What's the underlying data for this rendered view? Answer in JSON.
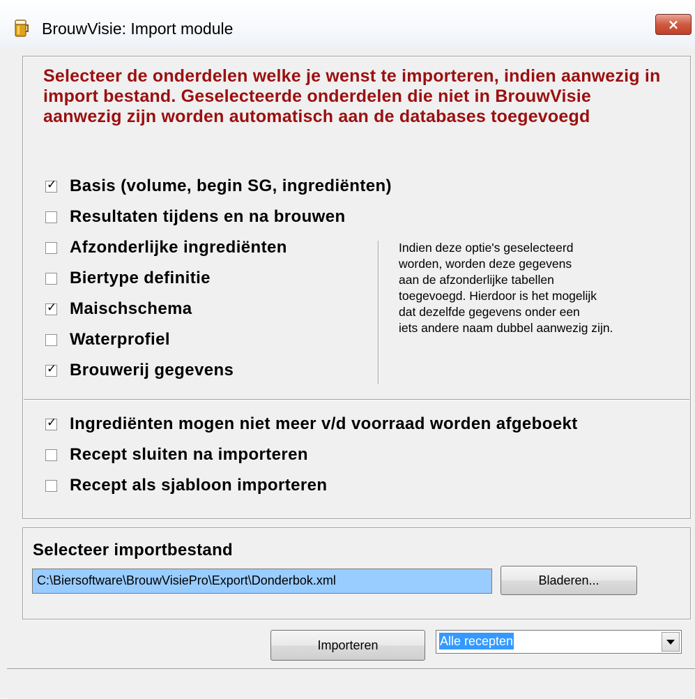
{
  "window": {
    "title": "BrouwVisie: Import module",
    "close_symbol": "×"
  },
  "heading": "Selecteer de onderdelen welke je wenst te importeren, indien aanwezig in import bestand. Geselecteerde onderdelen die niet in BrouwVisie aanwezig zijn worden automatisch aan de databases toegevoegd",
  "options": [
    {
      "label": "Basis (volume, begin SG, ingrediënten)",
      "checked": true
    },
    {
      "label": "Resultaten tijdens en na brouwen",
      "checked": false
    },
    {
      "label": "Afzonderlijke ingrediënten",
      "checked": false
    },
    {
      "label": "Biertype definitie",
      "checked": false
    },
    {
      "label": "Maischschema",
      "checked": true
    },
    {
      "label": "Waterprofiel",
      "checked": false
    },
    {
      "label": "Brouwerij gegevens",
      "checked": true
    },
    {
      "label": "Ingrediënten mogen niet meer v/d voorraad worden afgeboekt",
      "checked": true
    },
    {
      "label": "Recept sluiten na importeren",
      "checked": false
    },
    {
      "label": "Recept als sjabloon importeren",
      "checked": false
    }
  ],
  "note": "Indien deze optie's geselecteerd\nworden, worden deze gegevens\naan de afzonderlijke tabellen\ntoegevoegd.  Hierdoor is het mogelijk\ndat dezelfde gegevens onder een\niets andere naam dubbel aanwezig zijn.",
  "file": {
    "section_label": "Selecteer importbestand",
    "path": "C:\\Biersoftware\\BrouwVisiePro\\Export\\Donderbok.xml",
    "browse_label": "Bladeren..."
  },
  "actions": {
    "import_label": "Importeren",
    "scope_selected": "Alle recepten"
  }
}
